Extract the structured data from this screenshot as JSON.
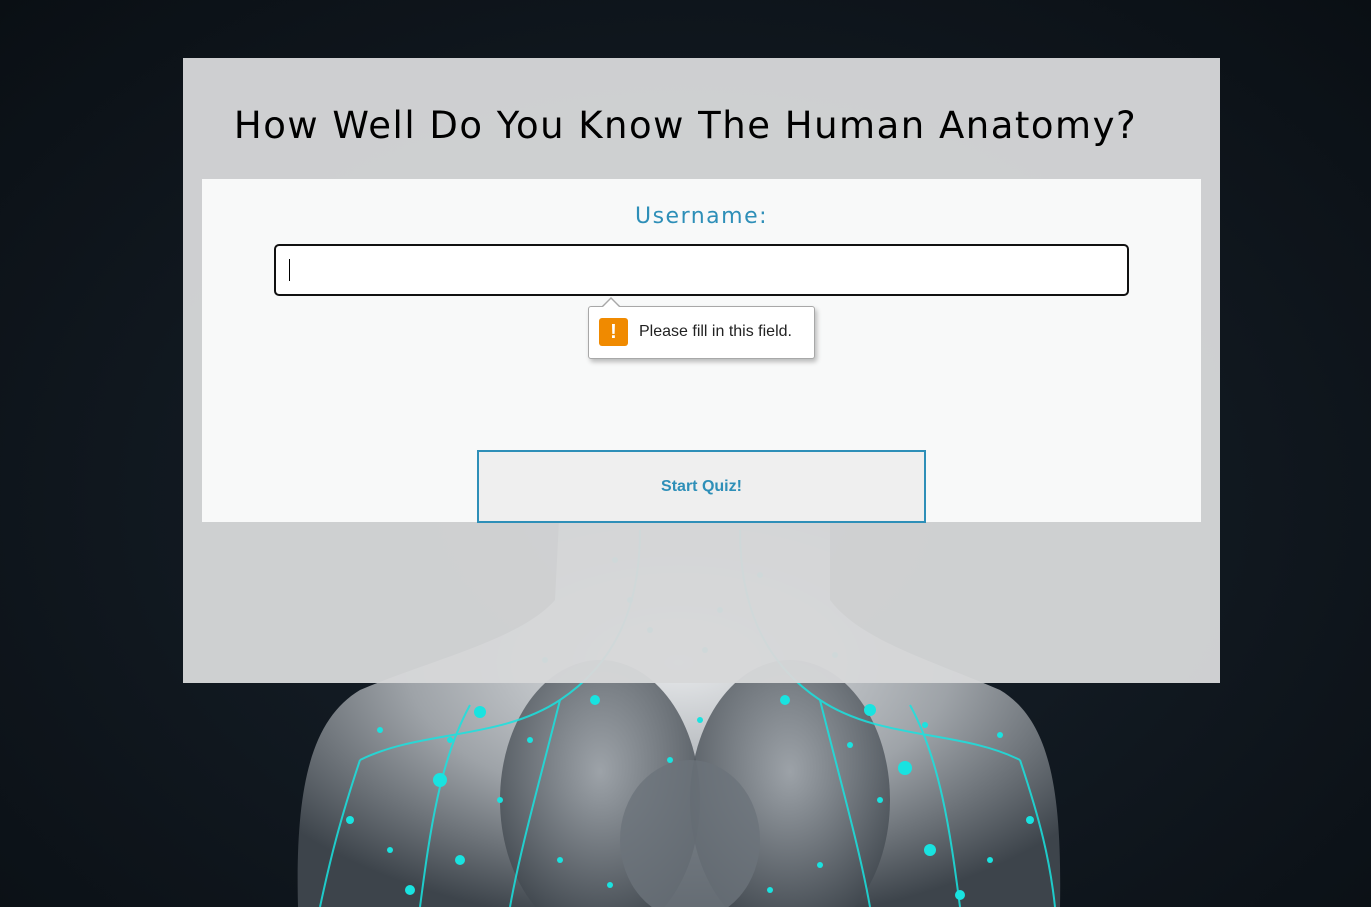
{
  "page": {
    "title": "How Well Do You Know The Human Anatomy?"
  },
  "form": {
    "username_label": "Username:",
    "username_value": "",
    "validation_message": "Please fill in this field.",
    "warning_glyph": "!",
    "start_button_label": "Start Quiz!"
  },
  "colors": {
    "accent": "#2e8fb8",
    "warning": "#f08a00",
    "panel": "#d6d7d9",
    "background": "#0a0f14",
    "lymph_glow": "#19e3e0"
  },
  "icons": {
    "warning": "warning-icon"
  }
}
